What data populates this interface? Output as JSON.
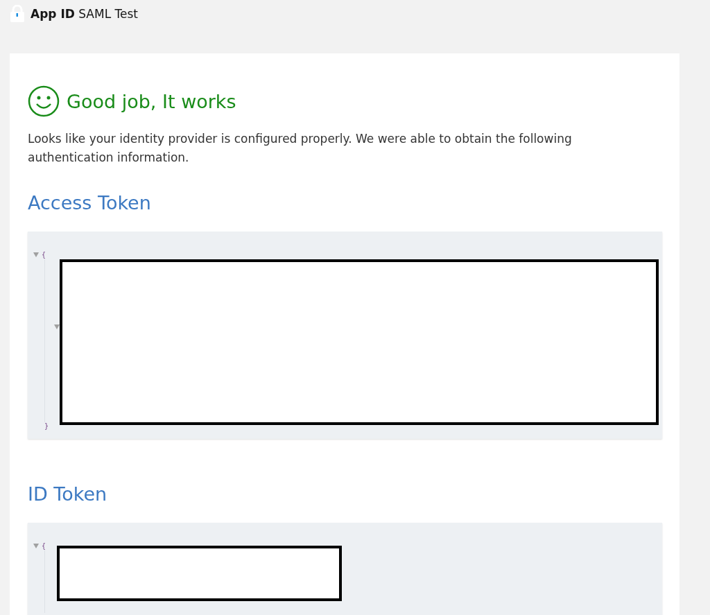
{
  "header": {
    "app_name": "App ID",
    "title": "SAML Test"
  },
  "result": {
    "heading": "Good job, It works",
    "message": "Looks like your identity provider is configured properly. We were able to obtain the following authentication information."
  },
  "tokens": [
    {
      "title": "Access Token",
      "open_brace": "{",
      "close_brace": "}",
      "expanded": true,
      "children": [
        {
          "expanded": true
        }
      ]
    },
    {
      "title": "ID Token",
      "open_brace": "{",
      "expanded": true
    }
  ]
}
